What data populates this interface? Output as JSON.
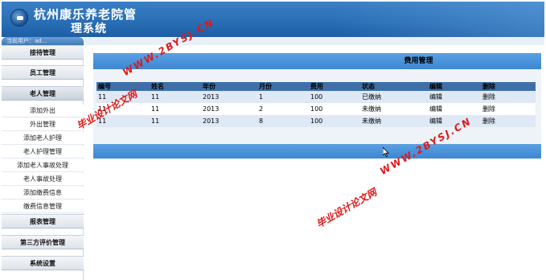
{
  "header": {
    "title_line1": "杭州康乐养老院管",
    "title_line2": "理系统"
  },
  "userbar": {
    "text": "当前用户：ad..."
  },
  "sidebar": {
    "groups": [
      {
        "label": "接待管理"
      },
      {
        "label": "员工管理"
      },
      {
        "label": "老人管理"
      },
      {
        "label": "报表管理"
      },
      {
        "label": "第三方评价管理"
      },
      {
        "label": "系统设置"
      }
    ],
    "subitems": [
      {
        "label": "添加外出"
      },
      {
        "label": "外出管理"
      },
      {
        "label": "添加老人护理"
      },
      {
        "label": "老人护理管理"
      },
      {
        "label": "添加老人事故处理"
      },
      {
        "label": "老人事故处理"
      },
      {
        "label": "添加缴费信息"
      },
      {
        "label": "缴费信息管理"
      }
    ]
  },
  "main": {
    "title": "费用管理",
    "columns": [
      "编号",
      "姓名",
      "年份",
      "月份",
      "费用",
      "状态",
      "编辑",
      "删除"
    ],
    "rows": [
      {
        "id": "11",
        "name": "11",
        "year": "2013",
        "month": "1",
        "fee": "100",
        "status": "已缴纳",
        "edit": "编辑",
        "delete": "删除"
      },
      {
        "id": "11",
        "name": "11",
        "year": "2013",
        "month": "2",
        "fee": "100",
        "status": "未缴纳",
        "edit": "编辑",
        "delete": "删除"
      },
      {
        "id": "11",
        "name": "11",
        "year": "2013",
        "month": "8",
        "fee": "100",
        "status": "未缴纳",
        "edit": "编辑",
        "delete": "删除"
      }
    ]
  },
  "watermarks": {
    "cn1": "毕业设计论文网",
    "url1": "WWW.2BYSJ.CN",
    "url2": "WWW.2BYSJ.CN",
    "cn2": "毕业设计论文网"
  },
  "colors": {
    "header_blue": "#2a6fb6",
    "panel_bar": "#4a93da",
    "table_header": "#3f6fa8",
    "watermark_red": "#e01818"
  }
}
